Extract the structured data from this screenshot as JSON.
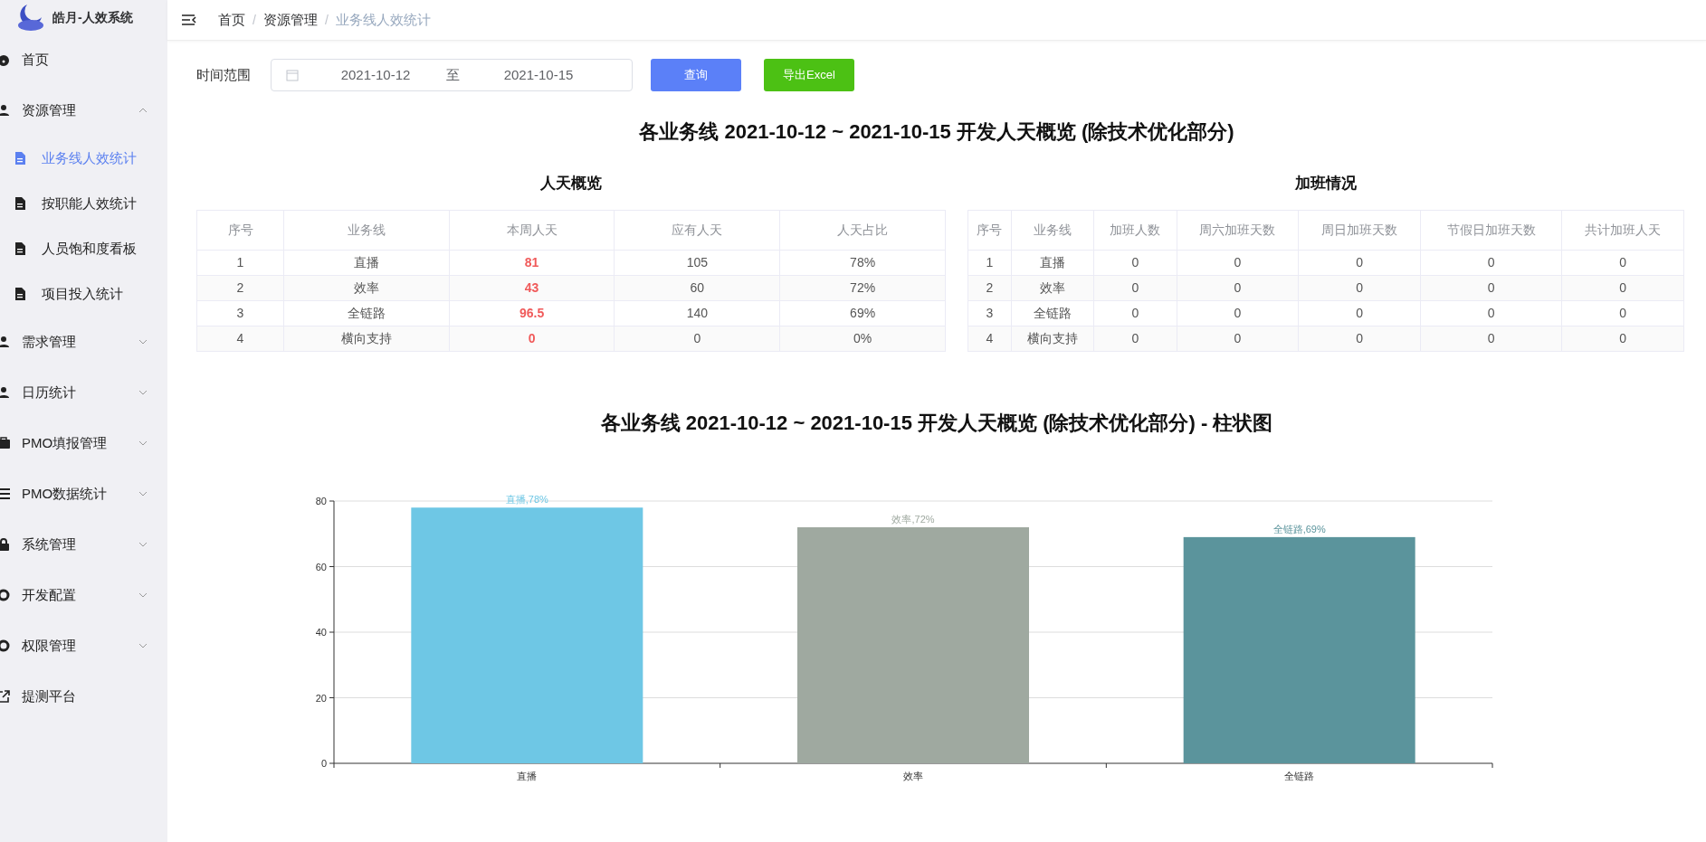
{
  "app": {
    "title": "皓月-人效系统"
  },
  "sidebar": {
    "items": [
      {
        "label": "首页",
        "expandable": false,
        "selected": false
      },
      {
        "label": "资源管理",
        "expandable": true,
        "expanded": true,
        "selected": false,
        "children": [
          {
            "label": "业务线人效统计",
            "selected": true
          },
          {
            "label": "按职能人效统计",
            "selected": false
          },
          {
            "label": "人员饱和度看板",
            "selected": false
          },
          {
            "label": "项目投入统计",
            "selected": false
          }
        ]
      },
      {
        "label": "需求管理",
        "expandable": true,
        "expanded": false,
        "selected": false
      },
      {
        "label": "日历统计",
        "expandable": true,
        "expanded": false,
        "selected": false
      },
      {
        "label": "PMO填报管理",
        "expandable": true,
        "expanded": false,
        "selected": false
      },
      {
        "label": "PMO数据统计",
        "expandable": true,
        "expanded": false,
        "selected": false
      },
      {
        "label": "系统管理",
        "expandable": true,
        "expanded": false,
        "selected": false
      },
      {
        "label": "开发配置",
        "expandable": true,
        "expanded": false,
        "selected": false
      },
      {
        "label": "权限管理",
        "expandable": true,
        "expanded": false,
        "selected": false
      },
      {
        "label": "提测平台",
        "expandable": false,
        "selected": false
      }
    ]
  },
  "breadcrumb": {
    "items": [
      "首页",
      "资源管理",
      "业务线人效统计"
    ],
    "separators": [
      "/",
      "/"
    ]
  },
  "filter": {
    "label": "时间范围",
    "start": "2021-10-12",
    "separator": "至",
    "end": "2021-10-15",
    "buttons": [
      {
        "label": "查询",
        "kind": "primary"
      },
      {
        "label": "导出Excel",
        "kind": "success"
      }
    ]
  },
  "page_title": "各业务线 2021-10-12 ~ 2021-10-15 开发人天概览 (除技术优化部分)",
  "tables": [
    {
      "title": "人天概览",
      "columns": [
        "序号",
        "业务线",
        "本周人天",
        "应有人天",
        "人天占比"
      ],
      "rows": [
        [
          "1",
          "直播",
          "81",
          "105",
          "78%"
        ],
        [
          "2",
          "效率",
          "43",
          "60",
          "72%"
        ],
        [
          "3",
          "全链路",
          "96.5",
          "140",
          "69%"
        ],
        [
          "4",
          "横向支持",
          "0",
          "0",
          "0%"
        ]
      ]
    },
    {
      "title": "加班情况",
      "columns": [
        "序号",
        "业务线",
        "加班人数",
        "周六加班天数",
        "周日加班天数",
        "节假日加班天数",
        "共计加班人天"
      ],
      "rows": [
        [
          "1",
          "直播",
          "0",
          "0",
          "0",
          "0",
          "0"
        ],
        [
          "2",
          "效率",
          "0",
          "0",
          "0",
          "0",
          "0"
        ],
        [
          "3",
          "全链路",
          "0",
          "0",
          "0",
          "0",
          "0"
        ],
        [
          "4",
          "横向支持",
          "0",
          "0",
          "0",
          "0",
          "0"
        ]
      ]
    }
  ],
  "chart": {
    "title": "各业务线 2021-10-12 ~ 2021-10-15 开发人天概览 (除技术优化部分) - 柱状图",
    "chart_data": {
      "type": "bar",
      "categories": [
        "直播",
        "效率",
        "全链路"
      ],
      "series": [
        {
          "color": "#6ec7e5",
          "values": [
            78,
            null,
            null
          ]
        },
        {
          "color": "#9fa9a0",
          "values": [
            null,
            72,
            null
          ]
        },
        {
          "color": "#5b949c",
          "values": [
            null,
            null,
            69
          ]
        }
      ],
      "stacked": true,
      "grid": true,
      "ylim": [
        0,
        80
      ],
      "yticks": [
        0,
        20,
        40,
        60,
        80
      ],
      "value_labels": [
        "直播,78%",
        "效率,72%",
        "全链路,69%"
      ]
    }
  }
}
